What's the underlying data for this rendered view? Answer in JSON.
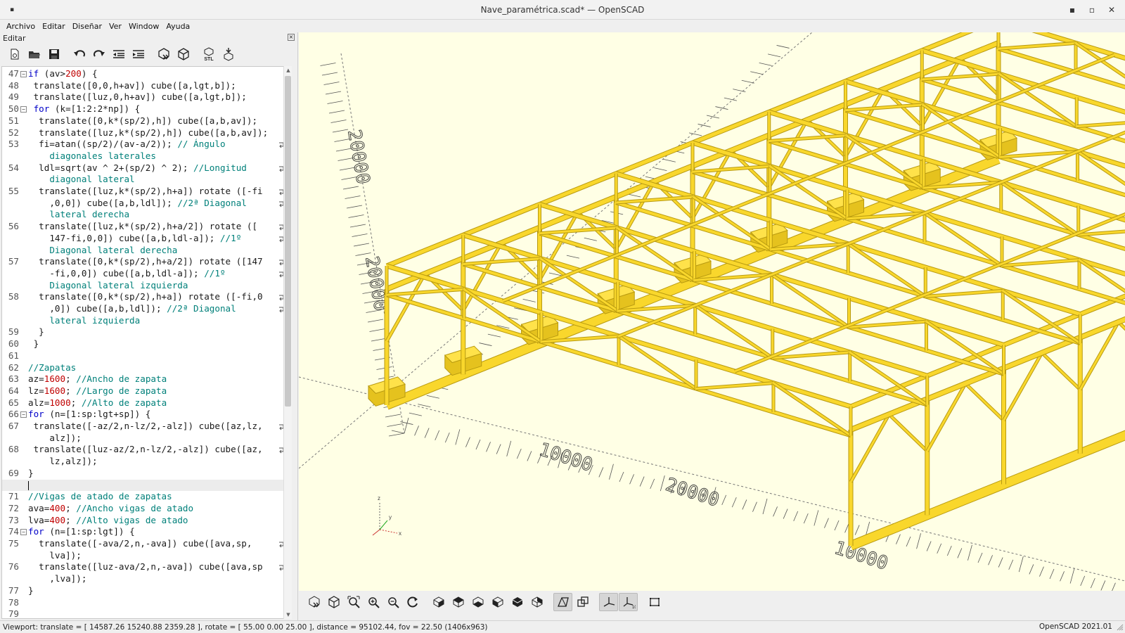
{
  "window": {
    "title": "Nave_paramétrica.scad* — OpenSCAD",
    "controls": {
      "minimize": "▪",
      "maximize": "▫",
      "close": "✕"
    }
  },
  "menubar": {
    "items": [
      "Archivo",
      "Editar",
      "Diseñar",
      "Ver",
      "Window",
      "Ayuda"
    ]
  },
  "editor": {
    "panel_title": "Editar",
    "toolbar": [
      {
        "name": "new-file-icon"
      },
      {
        "name": "open-file-icon"
      },
      {
        "name": "save-icon"
      },
      {
        "name": "undo-icon"
      },
      {
        "name": "redo-icon"
      },
      {
        "name": "unindent-icon"
      },
      {
        "name": "indent-icon"
      },
      {
        "name": "preview-icon"
      },
      {
        "name": "render-icon"
      },
      {
        "name": "export-stl-icon",
        "label": "STL"
      },
      {
        "name": "send-to-print-icon"
      }
    ],
    "cursor_line": 70,
    "lines": [
      {
        "n": "47",
        "fold": true,
        "parts": [
          [
            "kw",
            "if"
          ],
          [
            "t",
            " (av>"
          ],
          [
            "num",
            "200"
          ],
          [
            "t",
            ") {"
          ]
        ]
      },
      {
        "n": "48",
        "parts": [
          [
            "t",
            " translate([0,0,h+av]) cube([a,lgt,b]);"
          ]
        ]
      },
      {
        "n": "49",
        "parts": [
          [
            "t",
            " translate([luz,0,h+av]) cube([a,lgt,b]);"
          ]
        ]
      },
      {
        "n": "50",
        "fold": true,
        "parts": [
          [
            "t",
            " "
          ],
          [
            "kw",
            "for"
          ],
          [
            "t",
            " (k=[1:2:2*np]) {"
          ]
        ]
      },
      {
        "n": "51",
        "parts": [
          [
            "t",
            "  translate([0,k*(sp/2),h]) cube([a,b,av]);"
          ]
        ]
      },
      {
        "n": "52",
        "parts": [
          [
            "t",
            "  translate([luz,k*(sp/2),h]) cube([a,b,av]);"
          ]
        ]
      },
      {
        "n": "53",
        "wrap": true,
        "parts": [
          [
            "t",
            "  fi=atan((sp/2)/(av-a/2)); "
          ],
          [
            "cm",
            "// Ángulo"
          ]
        ]
      },
      {
        "n": "",
        "parts": [
          [
            "cm",
            "    diagonales laterales"
          ]
        ]
      },
      {
        "n": "54",
        "wrap": true,
        "parts": [
          [
            "t",
            "  ldl=sqrt(av ^ 2+(sp/2) ^ 2); "
          ],
          [
            "cm",
            "//Longitud"
          ]
        ]
      },
      {
        "n": "",
        "parts": [
          [
            "cm",
            "    diagonal lateral"
          ]
        ]
      },
      {
        "n": "55",
        "wrap": true,
        "parts": [
          [
            "t",
            "  translate([luz,k*(sp/2),h+a]) rotate ([-fi"
          ]
        ]
      },
      {
        "n": "",
        "wrap": true,
        "parts": [
          [
            "t",
            "    ,0,0]) cube([a,b,ldl]); "
          ],
          [
            "cm",
            "//2ª Diagonal"
          ]
        ]
      },
      {
        "n": "",
        "parts": [
          [
            "cm",
            "    lateral derecha"
          ]
        ]
      },
      {
        "n": "56",
        "wrap": true,
        "parts": [
          [
            "t",
            "  translate([luz,k*(sp/2),h+a/2]) rotate (["
          ]
        ]
      },
      {
        "n": "",
        "wrap": true,
        "parts": [
          [
            "t",
            "    147-fi,0,0]) cube([a,b,ldl-a]); "
          ],
          [
            "cm",
            "//1º"
          ]
        ]
      },
      {
        "n": "",
        "parts": [
          [
            "cm",
            "    Diagonal lateral derecha"
          ]
        ]
      },
      {
        "n": "57",
        "wrap": true,
        "parts": [
          [
            "t",
            "  translate([0,k*(sp/2),h+a/2]) rotate ([147"
          ]
        ]
      },
      {
        "n": "",
        "wrap": true,
        "parts": [
          [
            "t",
            "    -fi,0,0]) cube([a,b,ldl-a]); "
          ],
          [
            "cm",
            "//1º"
          ]
        ]
      },
      {
        "n": "",
        "parts": [
          [
            "cm",
            "    Diagonal lateral izquierda"
          ]
        ]
      },
      {
        "n": "58",
        "wrap": true,
        "parts": [
          [
            "t",
            "  translate([0,k*(sp/2),h+a]) rotate ([-fi,0"
          ]
        ]
      },
      {
        "n": "",
        "wrap": true,
        "parts": [
          [
            "t",
            "    ,0]) cube([a,b,ldl]); "
          ],
          [
            "cm",
            "//2ª Diagonal"
          ]
        ]
      },
      {
        "n": "",
        "parts": [
          [
            "cm",
            "    lateral izquierda"
          ]
        ]
      },
      {
        "n": "59",
        "parts": [
          [
            "t",
            "  }"
          ]
        ]
      },
      {
        "n": "60",
        "parts": [
          [
            "t",
            " }"
          ]
        ]
      },
      {
        "n": "61",
        "parts": [
          [
            "t",
            ""
          ]
        ]
      },
      {
        "n": "62",
        "parts": [
          [
            "cm",
            "//Zapatas"
          ]
        ]
      },
      {
        "n": "63",
        "parts": [
          [
            "t",
            "az="
          ],
          [
            "num",
            "1600"
          ],
          [
            "t",
            "; "
          ],
          [
            "cm",
            "//Ancho de zapata"
          ]
        ]
      },
      {
        "n": "64",
        "parts": [
          [
            "t",
            "lz="
          ],
          [
            "num",
            "1600"
          ],
          [
            "t",
            "; "
          ],
          [
            "cm",
            "//Largo de zapata"
          ]
        ]
      },
      {
        "n": "65",
        "parts": [
          [
            "t",
            "alz="
          ],
          [
            "num",
            "1000"
          ],
          [
            "t",
            "; "
          ],
          [
            "cm",
            "//Alto de zapata"
          ]
        ]
      },
      {
        "n": "66",
        "fold": true,
        "parts": [
          [
            "kw",
            "for"
          ],
          [
            "t",
            " (n=[1:sp:lgt+sp]) {"
          ]
        ]
      },
      {
        "n": "67",
        "wrap": true,
        "parts": [
          [
            "t",
            " translate([-az/2,n-lz/2,-alz]) cube([az,lz,"
          ]
        ]
      },
      {
        "n": "",
        "parts": [
          [
            "t",
            "    alz]);"
          ]
        ]
      },
      {
        "n": "68",
        "wrap": true,
        "parts": [
          [
            "t",
            " translate([luz-az/2,n-lz/2,-alz]) cube([az,"
          ]
        ]
      },
      {
        "n": "",
        "parts": [
          [
            "t",
            "    lz,alz]);"
          ]
        ]
      },
      {
        "n": "69",
        "parts": [
          [
            "t",
            "}"
          ]
        ]
      },
      {
        "n": "70",
        "parts": [
          [
            "t",
            ""
          ]
        ]
      },
      {
        "n": "71",
        "parts": [
          [
            "cm",
            "//Vigas de atado de zapatas"
          ]
        ]
      },
      {
        "n": "72",
        "parts": [
          [
            "t",
            "ava="
          ],
          [
            "num",
            "400"
          ],
          [
            "t",
            "; "
          ],
          [
            "cm",
            "//Ancho vigas de atado"
          ]
        ]
      },
      {
        "n": "73",
        "parts": [
          [
            "t",
            "lva="
          ],
          [
            "num",
            "400"
          ],
          [
            "t",
            "; "
          ],
          [
            "cm",
            "//Alto vigas de atado"
          ]
        ]
      },
      {
        "n": "74",
        "fold": true,
        "parts": [
          [
            "kw",
            "for"
          ],
          [
            "t",
            " (n=[1:sp:lgt]) {"
          ]
        ]
      },
      {
        "n": "75",
        "wrap": true,
        "parts": [
          [
            "t",
            "  translate([-ava/2,n,-ava]) cube([ava,sp,"
          ]
        ]
      },
      {
        "n": "",
        "parts": [
          [
            "t",
            "    lva]);"
          ]
        ]
      },
      {
        "n": "76",
        "wrap": true,
        "parts": [
          [
            "t",
            "  translate([luz-ava/2,n,-ava]) cube([ava,sp"
          ]
        ]
      },
      {
        "n": "",
        "parts": [
          [
            "t",
            "    ,lva]);"
          ]
        ]
      },
      {
        "n": "77",
        "parts": [
          [
            "t",
            "}"
          ]
        ]
      },
      {
        "n": "78",
        "parts": [
          [
            "t",
            ""
          ]
        ]
      },
      {
        "n": "79",
        "parts": [
          [
            "t",
            ""
          ]
        ]
      }
    ]
  },
  "viewport": {
    "background": "#ffffe5",
    "model_color": "#f9d72c",
    "model_stroke": "#b89a10",
    "axis_labels": [
      "20000",
      "20000",
      "10000",
      "20000",
      "10000"
    ],
    "mini_axes": {
      "x": "x",
      "y": "y",
      "z": "z"
    }
  },
  "view_toolbar": [
    {
      "name": "preview-render-icon"
    },
    {
      "name": "render-cube-icon"
    },
    {
      "name": "view-all-icon"
    },
    {
      "name": "zoom-in-icon"
    },
    {
      "name": "zoom-out-icon"
    },
    {
      "name": "reset-view-icon"
    },
    {
      "name": "view-right-icon"
    },
    {
      "name": "view-top-icon"
    },
    {
      "name": "view-bottom-icon"
    },
    {
      "name": "view-left-icon"
    },
    {
      "name": "view-front-icon"
    },
    {
      "name": "view-back-icon"
    },
    {
      "name": "perspective-icon",
      "active": true
    },
    {
      "name": "orthogonal-icon"
    },
    {
      "name": "show-axes-icon",
      "active": true
    },
    {
      "name": "show-scale-markers-icon",
      "active": true
    },
    {
      "name": "show-edges-icon"
    }
  ],
  "statusbar": {
    "viewport_info": "Viewport: translate = [ 14587.26 15240.88 2359.28 ], rotate = [ 55.00 0.00 25.00 ], distance = 95102.44, fov = 22.50 (1406x963)",
    "version": "OpenSCAD 2021.01"
  }
}
